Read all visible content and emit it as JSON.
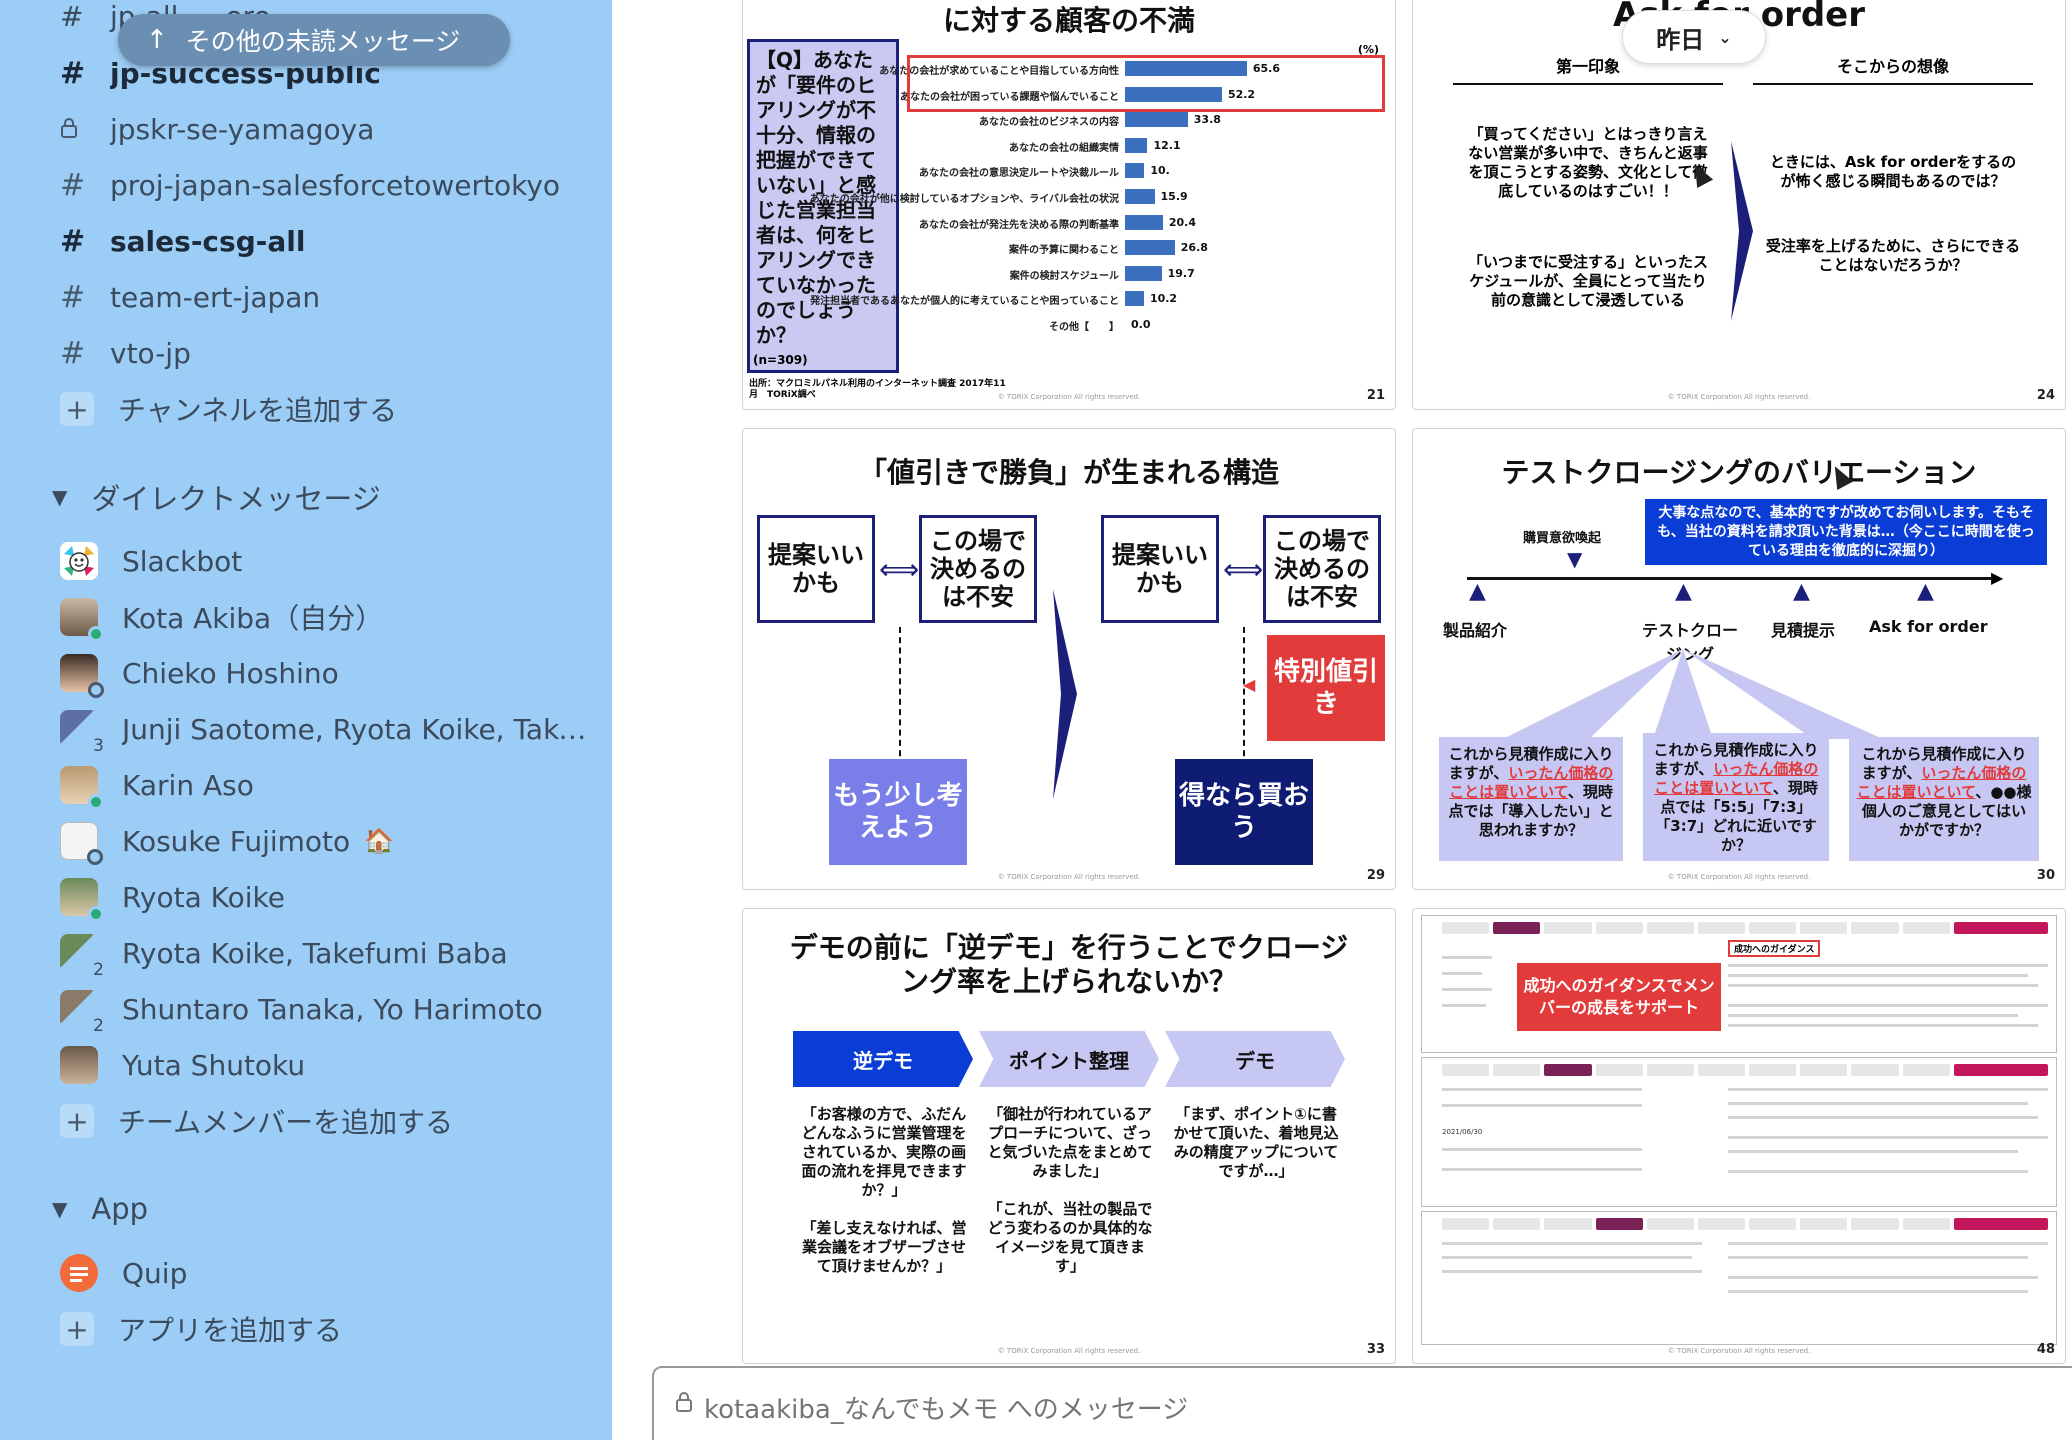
{
  "sidebar": {
    "unread_pill": "その他の未読メッセージ",
    "top_faded_channel": "jp-all-...-ere-...",
    "channels": [
      {
        "name": "jp-success-public",
        "glyph": "#",
        "bold": true
      },
      {
        "name": "jpskr-se-yamagoya",
        "glyph": "lock",
        "bold": false
      },
      {
        "name": "proj-japan-salesforcetowertokyo",
        "glyph": "#",
        "bold": false
      },
      {
        "name": "sales-csg-all",
        "glyph": "#",
        "bold": true
      },
      {
        "name": "team-ert-japan",
        "glyph": "#",
        "bold": false
      },
      {
        "name": "vto-jp",
        "glyph": "#",
        "bold": false
      }
    ],
    "add_channel": "チャンネルを追加する",
    "dm_header": "ダイレクトメッセージ",
    "dms": [
      {
        "name": "Slackbot",
        "avatar": "slackbot",
        "presence": "none",
        "count": ""
      },
      {
        "name": "Kota Akiba（自分）",
        "avatar": "person",
        "presence": "active",
        "count": ""
      },
      {
        "name": "Chieko Hoshino",
        "avatar": "person",
        "presence": "away",
        "count": ""
      },
      {
        "name": "Junji Saotome, Ryota Koike, Take...",
        "avatar": "group",
        "presence": "none",
        "count": "3"
      },
      {
        "name": "Karin Aso",
        "avatar": "person",
        "presence": "active",
        "count": ""
      },
      {
        "name": "Kosuke Fujimoto",
        "avatar": "person",
        "presence": "away",
        "count": "",
        "emoji": "🏠"
      },
      {
        "name": "Ryota Koike",
        "avatar": "person",
        "presence": "active",
        "count": ""
      },
      {
        "name": "Ryota Koike, Takefumi Baba",
        "avatar": "group",
        "presence": "none",
        "count": "2"
      },
      {
        "name": "Shuntaro Tanaka, Yo Harimoto",
        "avatar": "group",
        "presence": "none",
        "count": "2"
      },
      {
        "name": "Yuta Shutoku",
        "avatar": "person",
        "presence": "none",
        "count": ""
      }
    ],
    "add_member": "チームメンバーを追加する",
    "app_header": "App",
    "apps": [
      {
        "name": "Quip"
      }
    ],
    "add_app": "アプリを追加する"
  },
  "date_pill": "昨日",
  "slides": {
    "s1": {
      "title": "に対する顧客の不満",
      "question": "【Q】あなたが「要件のヒアリングが不十分、情報の把握ができていない」と感じた営業担当者は、何をヒアリングできていなかったのでしょうか？",
      "unit": "(%)",
      "n": "(n=309)",
      "source": "出所：マクロミルパネル利用のインターネット調査 2017年11月　TORiX調べ",
      "page": "21",
      "copyright": "© TORiX Corporation All rights reserved."
    },
    "s2": {
      "title": "Ask for order",
      "col1": "第一印象",
      "col2": "そこからの想像",
      "left_p1": "「買ってください」とはっきり言えない営業が多い中で、きちんと返事を頂こうとする姿勢、文化として徹底しているのはすごい！！",
      "left_p2": "「いつまでに受注する」といったスケジュールが、全員にとって当たり前の意識として浸透している",
      "right_p1": "ときには、Ask for orderをするのが怖く感じる瞬間もあるのでは？",
      "right_p2": "受注率を上げるために、さらにできることはないだろうか？",
      "page": "24",
      "copyright": "© TORiX Corporation All rights reserved."
    },
    "s3": {
      "title": "「値引きで勝負」が生まれる構造",
      "box_teian": "提案いいかも",
      "box_fuan": "この場で決めるのは不安",
      "box_mou": "もう少し考えよう",
      "box_tokubetsu": "特別値引き",
      "box_etoku": "得なら買おう",
      "page": "29",
      "copyright": "© TORiX Corporation All rights reserved."
    },
    "s4": {
      "title": "テストクロージングのバリエーション",
      "callout": "大事な点なので、基本的ですが改めてお伺いします。そもそも、当社の資料を請求頂いた背景は…（今ここに時間を使っている理由を徹底的に深掘り）",
      "kaikan": "購買意欲喚起",
      "m1": "製品紹介",
      "m2": "テストクロージング",
      "m3": "見積提示",
      "m4": "Ask for order",
      "b1_pre": "これから見積作成に入りますが、",
      "b1_red": "いったん価格のことは置いといて",
      "b1_post": "、現時点では「導入したい」と思われますか？",
      "b2_pre": "これから見積作成に入りますが、",
      "b2_red": "いったん価格のことは置いといて",
      "b2_post": "、現時点では「5:5」「7:3」「3:7」どれに近いですか？",
      "b3_pre": "これから見積作成に入りますが、",
      "b3_red": "いったん価格のことは置いといて",
      "b3_post": "、●●様個人のご意見としてはいかがですか？",
      "page": "30",
      "copyright": "© TORiX Corporation All rights reserved."
    },
    "s5": {
      "title": "デモの前に「逆デモ」を行うことでクロージング率を上げられないか？",
      "c1": "逆デモ",
      "c2": "ポイント整理",
      "c3": "デモ",
      "t1": "「お客様の方で、ふだんどんなふうに営業管理をされているか、実際の画面の流れを拝見できますか？」\n\n「差し支えなければ、営業会議をオブザーブさせて頂けませんか？」",
      "t2": "「御社が行われているアプローチについて、ざっと気づいた点をまとめてみました」\n\n「これが、当社の製品でどう変わるのか具体的なイメージを見て頂きます」",
      "t3": "「まず、ポイント①に書かせて頂いた、着地見込みの精度アップについてですが…」",
      "page": "33",
      "copyright": "© TORiX Corporation All rights reserved."
    },
    "s6": {
      "callout": "成功へのガイダンスでメンバーの成長をサポート",
      "guidance_label": "成功へのガイダンス",
      "date_value": "2021/06/30",
      "page": "48",
      "copyright": "© TORiX Corporation All rights reserved."
    }
  },
  "chart_data": {
    "type": "bar",
    "orientation": "horizontal",
    "title": "",
    "unit": "%",
    "categories": [
      "あなたの会社が求めていることや目指している方向性",
      "あなたの会社が困っている課題や悩んでいること",
      "あなたの会社のビジネスの内容",
      "あなたの会社の組織実情",
      "あなたの会社の意思決定ルートや決裁ルール",
      "あなたの会社が他に検討しているオプションや、ライバル会社の状況",
      "あなたの会社が発注先を決める際の判断基準",
      "案件の予算に関わること",
      "案件の検討スケジュール",
      "発注担当者であるあなたが個人的に考えていることや困っていること",
      "その他【　　】"
    ],
    "values": [
      65.6,
      52.2,
      33.8,
      12.1,
      10.4,
      15.9,
      20.4,
      26.8,
      19.7,
      10.2,
      0.0
    ],
    "value_labels": [
      "65.6",
      "52.2",
      "33.8",
      "12.1",
      "10.",
      "15.9",
      "20.4",
      "26.8",
      "19.7",
      "10.2",
      "0.0"
    ],
    "highlighted": [
      0,
      1
    ],
    "colors": {
      "bar": "#3d6fbf",
      "highlight_box": "#e23b3b"
    }
  },
  "composer": {
    "placeholder": "kotaakiba_なんでもメモ へのメッセージ"
  },
  "colors": {
    "sidebar_bg": "#9ccdf6",
    "navy": "#1b1f7a",
    "lavender": "#c7c7f3",
    "red": "#e23b3b",
    "blue": "#0a3cd6"
  }
}
